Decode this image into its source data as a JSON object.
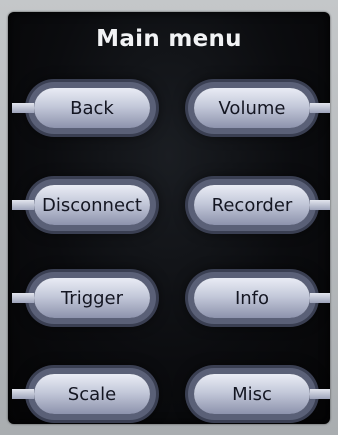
{
  "menu": {
    "title": "Main menu",
    "buttons": [
      {
        "label": "Back"
      },
      {
        "label": "Volume"
      },
      {
        "label": "Disconnect"
      },
      {
        "label": "Recorder"
      },
      {
        "label": "Trigger"
      },
      {
        "label": "Info"
      },
      {
        "label": "Scale"
      },
      {
        "label": "Misc"
      }
    ]
  },
  "colors": {
    "screen_background": "#0b0c0f",
    "button_face": "#c4c9da",
    "button_ring": "#5a6077",
    "title_text": "#f2f3f5",
    "button_text": "#141622"
  }
}
